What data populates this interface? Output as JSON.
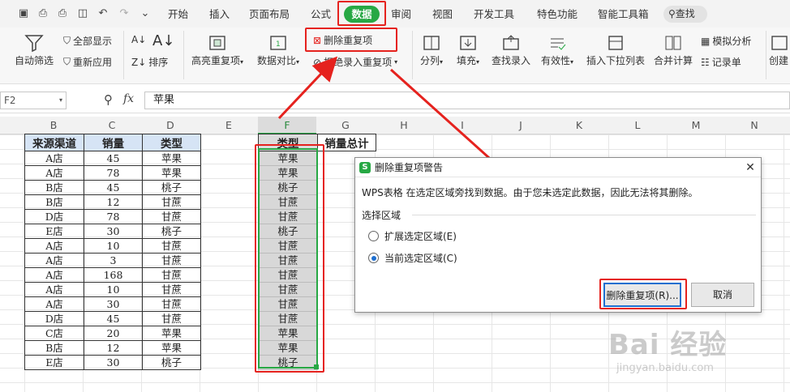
{
  "menubar": {
    "items": [
      "开始",
      "插入",
      "页面布局",
      "公式",
      "数据",
      "审阅",
      "视图",
      "开发工具",
      "特色功能",
      "智能工具箱"
    ],
    "active": "数据",
    "search_label": "查找"
  },
  "ribbon": {
    "auto_filter": "自动筛选",
    "show_all": "全部显示",
    "reapply": "重新应用",
    "sort": "排序",
    "highlight_dup": "高亮重复项",
    "compare": "数据对比",
    "delete_dup": "删除重复项",
    "reject_dup": "拒绝录入重复项",
    "split": "分列",
    "fill": "填充",
    "find_entry": "查找录入",
    "validity": "有效性",
    "dropdown": "插入下拉列表",
    "merge_calc": "合并计算",
    "simulate": "模拟分析",
    "record": "记录单",
    "create": "创建"
  },
  "formula_bar": {
    "name_box": "F2",
    "fx": "fx",
    "value": "苹果"
  },
  "columns": [
    "B",
    "C",
    "D",
    "E",
    "F",
    "G",
    "H",
    "I",
    "J",
    "K",
    "L",
    "M",
    "N"
  ],
  "table": {
    "headers": [
      "来源渠道",
      "销量",
      "类型"
    ],
    "rows": [
      [
        "A店",
        "45",
        "苹果"
      ],
      [
        "A店",
        "78",
        "苹果"
      ],
      [
        "B店",
        "45",
        "桃子"
      ],
      [
        "B店",
        "12",
        "甘蔗"
      ],
      [
        "D店",
        "78",
        "甘蔗"
      ],
      [
        "E店",
        "30",
        "桃子"
      ],
      [
        "A店",
        "10",
        "甘蔗"
      ],
      [
        "A店",
        "3",
        "甘蔗"
      ],
      [
        "A店",
        "168",
        "甘蔗"
      ],
      [
        "A店",
        "10",
        "甘蔗"
      ],
      [
        "A店",
        "30",
        "甘蔗"
      ],
      [
        "D店",
        "45",
        "甘蔗"
      ],
      [
        "C店",
        "20",
        "苹果"
      ],
      [
        "B店",
        "12",
        "苹果"
      ],
      [
        "E店",
        "30",
        "桃子"
      ]
    ]
  },
  "f_column": {
    "header": "类型",
    "g_header": "销量总计",
    "values": [
      "苹果",
      "苹果",
      "桃子",
      "甘蔗",
      "甘蔗",
      "桃子",
      "甘蔗",
      "甘蔗",
      "甘蔗",
      "甘蔗",
      "甘蔗",
      "甘蔗",
      "苹果",
      "苹果",
      "桃子"
    ]
  },
  "dialog": {
    "title": "删除重复项警告",
    "message": "WPS表格 在选定区域旁找到数据。由于您未选定此数据，因此无法将其删除。",
    "section": "选择区域",
    "option_expand": "扩展选定区域(E)",
    "option_current": "当前选定区域(C)",
    "selected": "current",
    "ok_label": "删除重复项(R)...",
    "cancel_label": "取消",
    "logo": "S"
  },
  "watermark": {
    "brand": "Bai 经验",
    "url": "jingyan.baidu.com"
  },
  "colors": {
    "accent": "#27a844",
    "annotation": "#e5221e",
    "dialog_button": "#1e6fd0"
  }
}
